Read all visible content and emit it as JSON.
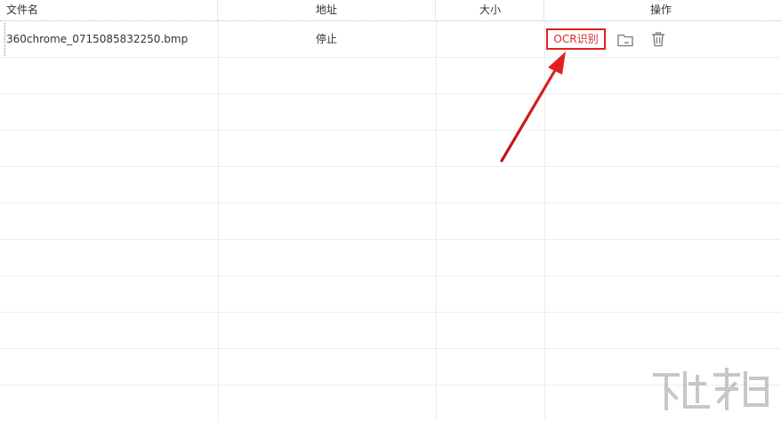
{
  "table": {
    "headers": {
      "filename": "文件名",
      "address": "地址",
      "size": "大小",
      "actions": "操作"
    },
    "rows": [
      {
        "filename": "360chrome_0715085832250.bmp",
        "address": "停止",
        "size": ""
      }
    ]
  },
  "actions": {
    "ocr_label": "OCR识别",
    "open_folder_icon": "folder-icon",
    "delete_icon": "trash-icon"
  },
  "colors": {
    "highlight": "#e02020",
    "ocr_text": "#d82a2a",
    "grid": "#ededed"
  },
  "watermark": {
    "logo_icon": "xiazaiba-logo"
  }
}
